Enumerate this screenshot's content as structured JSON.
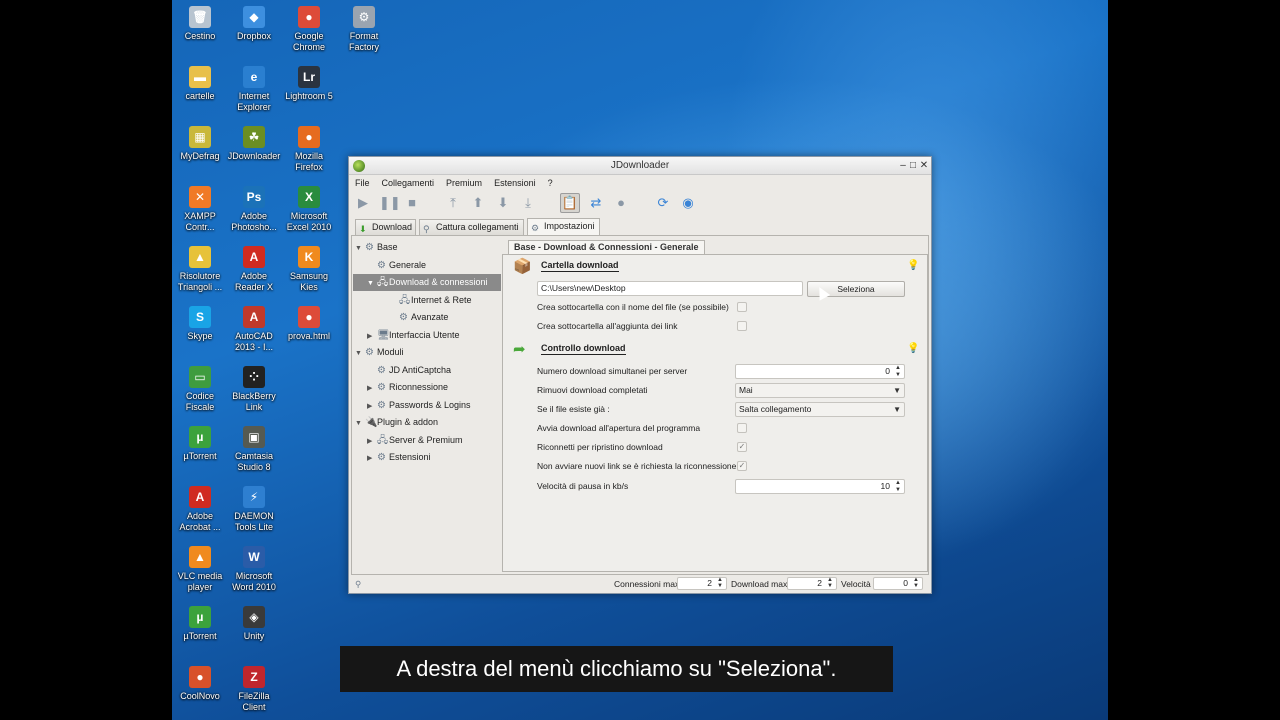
{
  "desktop": {
    "icons": [
      {
        "label": "Cestino",
        "icon": "recycle-bin-icon",
        "glyph": "🗑",
        "color": "#b8c4d0"
      },
      {
        "label": "Dropbox",
        "icon": "dropbox-icon",
        "glyph": "◆",
        "color": "#3d8fdf"
      },
      {
        "label": "Google Chrome",
        "icon": "chrome-icon",
        "glyph": "●",
        "color": "#dd4b39"
      },
      {
        "label": "Format Factory",
        "icon": "format-factory-icon",
        "glyph": "⚙",
        "color": "#9aa4b0"
      },
      {
        "label": "cartelle",
        "icon": "folder-icon",
        "glyph": "▬",
        "color": "#e8c04a"
      },
      {
        "label": "Internet Explorer",
        "icon": "ie-icon",
        "glyph": "e",
        "color": "#2a7fd0"
      },
      {
        "label": "Lightroom 5",
        "icon": "lightroom-icon",
        "glyph": "Lr",
        "color": "#2b3440"
      },
      {
        "label": "MyDefrag",
        "icon": "mydefrag-icon",
        "glyph": "▦",
        "color": "#c9b83a"
      },
      {
        "label": "JDownloader",
        "icon": "jdownloader-icon",
        "glyph": "☘",
        "color": "#6b8e23"
      },
      {
        "label": "Mozilla Firefox",
        "icon": "firefox-icon",
        "glyph": "●",
        "color": "#e66b1f"
      },
      {
        "label": "XAMPP Contr...",
        "icon": "xampp-icon",
        "glyph": "✕",
        "color": "#f07a26"
      },
      {
        "label": "Adobe Photosho...",
        "icon": "photoshop-icon",
        "glyph": "Ps",
        "color": "#1b72b8"
      },
      {
        "label": "Microsoft Excel 2010",
        "icon": "excel-icon",
        "glyph": "X",
        "color": "#2a8c3e"
      },
      {
        "label": "Risolutore Triangoli ...",
        "icon": "triangle-icon",
        "glyph": "▲",
        "color": "#e7c23a"
      },
      {
        "label": "Adobe Reader X",
        "icon": "adobe-reader-icon",
        "glyph": "A",
        "color": "#d02b20"
      },
      {
        "label": "Samsung Kies",
        "icon": "kies-icon",
        "glyph": "K",
        "color": "#f08a1e"
      },
      {
        "label": "Skype",
        "icon": "skype-icon",
        "glyph": "S",
        "color": "#19a4e6"
      },
      {
        "label": "AutoCAD 2013 - I...",
        "icon": "autocad-icon",
        "glyph": "A",
        "color": "#c0392b"
      },
      {
        "label": "prova.html",
        "icon": "html-file-icon",
        "glyph": "●",
        "color": "#dd4b39"
      },
      {
        "label": "Codice Fiscale",
        "icon": "codice-fiscale-icon",
        "glyph": "▭",
        "color": "#3f9c3f"
      },
      {
        "label": "BlackBerry Link",
        "icon": "blackberry-icon",
        "glyph": "⁘",
        "color": "#222222"
      },
      {
        "label": "µTorrent",
        "icon": "utorrent-icon",
        "glyph": "µ",
        "color": "#3ca23c"
      },
      {
        "label": "Camtasia Studio 8",
        "icon": "camtasia-icon",
        "glyph": "▣",
        "color": "#555a52"
      },
      {
        "label": "Adobe Acrobat ...",
        "icon": "acrobat-icon",
        "glyph": "A",
        "color": "#d02b20"
      },
      {
        "label": "DAEMON Tools Lite",
        "icon": "daemon-tools-icon",
        "glyph": "⚡",
        "color": "#2e7fd0"
      },
      {
        "label": "VLC media player",
        "icon": "vlc-icon",
        "glyph": "▲",
        "color": "#f08a1e"
      },
      {
        "label": "Microsoft Word 2010",
        "icon": "word-icon",
        "glyph": "W",
        "color": "#2a5ca8"
      },
      {
        "label": "µTorrent",
        "icon": "utorrent-icon",
        "glyph": "µ",
        "color": "#3ca23c"
      },
      {
        "label": "Unity",
        "icon": "unity-icon",
        "glyph": "◈",
        "color": "#3a3a3a"
      },
      {
        "label": "CoolNovo",
        "icon": "coolnovo-icon",
        "glyph": "●",
        "color": "#d8512a"
      },
      {
        "label": "FileZilla Client",
        "icon": "filezilla-icon",
        "glyph": "Z",
        "color": "#c0262d"
      }
    ]
  },
  "window": {
    "title": "JDownloader",
    "menu": [
      "File",
      "Collegamenti",
      "Premium",
      "Estensioni",
      "?"
    ],
    "tabs": [
      "Download",
      "Cattura collegamenti",
      "Impostazioni"
    ],
    "active_tab": "Impostazioni"
  },
  "tree": [
    {
      "label": "Base",
      "level": 0,
      "expanded": true
    },
    {
      "label": "Generale",
      "level": 1
    },
    {
      "label": "Download & connessioni",
      "level": 1,
      "expanded": true,
      "selected": true
    },
    {
      "label": "Internet & Rete",
      "level": 2
    },
    {
      "label": "Avanzate",
      "level": 2
    },
    {
      "label": "Interfaccia Utente",
      "level": 1,
      "collapsed": true
    },
    {
      "label": "Moduli",
      "level": 0,
      "expanded": true
    },
    {
      "label": "JD AntiCaptcha",
      "level": 1
    },
    {
      "label": "Riconnessione",
      "level": 1,
      "collapsed": true
    },
    {
      "label": "Passwords & Logins",
      "level": 1,
      "collapsed": true
    },
    {
      "label": "Plugin & addon",
      "level": 0,
      "expanded": true
    },
    {
      "label": "Server & Premium",
      "level": 1,
      "collapsed": true
    },
    {
      "label": "Estensioni",
      "level": 1,
      "collapsed": true
    }
  ],
  "panel": {
    "tab_label": "Base - Download & Connessioni - Generale",
    "section_download_folder": "Cartella download",
    "download_path": "C:\\Users\\new\\Desktop",
    "select_button": "Seleziona",
    "subfolder_package_label": "Crea sottocartella con il nome del file (se possibile)",
    "subfolder_link_label": "Crea sottocartella all'aggiunta dei link",
    "section_download_control": "Controllo download",
    "simultaneous_label": "Numero download simultanei per server",
    "simultaneous_value": "0",
    "remove_finished_label": "Rimuovi download completati",
    "remove_finished_value": "Mai",
    "file_exists_label": "Se il file esiste già :",
    "file_exists_value": "Salta collegamento",
    "autostart_label": "Avvia download all'apertura del programma",
    "reconnect_label": "Riconnetti per ripristino download",
    "no_new_links_label": "Non avviare nuovi link se è richiesta la riconnessione",
    "pause_speed_label": "Velocità di pausa in kb/s",
    "pause_speed_value": "10",
    "checkboxes": {
      "subfolder_package": false,
      "subfolder_link": false,
      "autostart": false,
      "reconnect": true,
      "no_new_links": true
    }
  },
  "status": {
    "max_connections_label": "Connessioni max",
    "max_connections_value": "2",
    "max_downloads_label": "Download max",
    "max_downloads_value": "2",
    "speed_label": "Velocità",
    "speed_value": "0"
  },
  "subtitle": "A destra del menù clicchiamo su \"Seleziona\"."
}
